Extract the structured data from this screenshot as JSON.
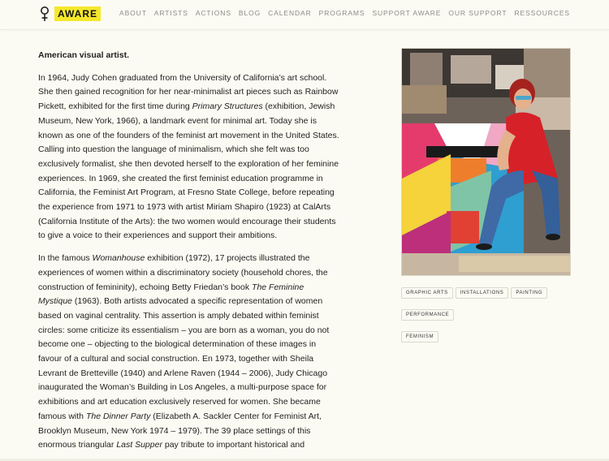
{
  "brand": {
    "name": "AWARE",
    "accent": "#f5e82a"
  },
  "nav": [
    "ABOUT",
    "ARTISTS",
    "ACTIONS",
    "BLOG",
    "CALENDAR",
    "PROGRAMS",
    "SUPPORT AWARE",
    "OUR SUPPORT",
    "RESSOURCES"
  ],
  "article": {
    "lead": "American visual artist.",
    "p1": [
      {
        "text": "In 1964, Judy Cohen graduated from the University of California’s art school. She then gained recognition for her near-minimalist art pieces such as Rainbow Pickett, exhibited for the first time during "
      },
      {
        "text": "Primary Structures",
        "em": true
      },
      {
        "text": " (exhibition, Jewish Museum, New York, 1966), a landmark event for minimal art. Today she is known as one of the founders of the feminist art movement in the United States. Calling into question the language of minimalism, which she felt was too exclusively formalist, she then devoted herself to the exploration of her feminine experiences. In 1969, she created the first feminist education programme in California, the Feminist Art Program, at Fresno State College, before repeating the experience from 1971 to 1973 with artist Miriam Shapiro (1923) at CalArts (California Institute of the Arts): the two women would encourage their students to give a voice to their experiences and support their ambitions."
      }
    ],
    "p2": [
      {
        "text": "In the famous "
      },
      {
        "text": "Womanhouse",
        "em": true
      },
      {
        "text": " exhibition (1972), 17 projects illustrated the experiences of women within a discriminatory society (household chores, the construction of femininity), echoing Betty Friedan’s book "
      },
      {
        "text": "The Feminine Mystique",
        "em": true
      },
      {
        "text": " (1963). Both artists advocated a specific representation of women based on vaginal centrality. This assertion is amply debated within feminist circles: some criticize its essentialism – you are born as a woman, you do not become one – objecting to the biological determination of these images in favour of a cultural and social construction. En 1973, together with Sheila Levrant de Bretteville (1940) and Arlene Raven (1944 – 2006), Judy Chicago inaugurated the Woman’s Building in Los Angeles, a multi-purpose space for exhibitions and art education exclusively reserved for women. She became famous with "
      },
      {
        "text": "The Dinner Party",
        "em": true
      },
      {
        "text": " (Elizabeth A. Sackler Center for Feminist Art, Brooklyn Museum, New York 1974 – 1979). The 39 place settings of this enormous triangular "
      },
      {
        "text": "Last Supper",
        "em": true
      },
      {
        "text": " pay tribute to important historical and"
      }
    ]
  },
  "tags": [
    "GRAPHIC ARTS",
    "INSTALLATIONS",
    "PAINTING",
    "PERFORMANCE",
    "FEMINISM"
  ]
}
